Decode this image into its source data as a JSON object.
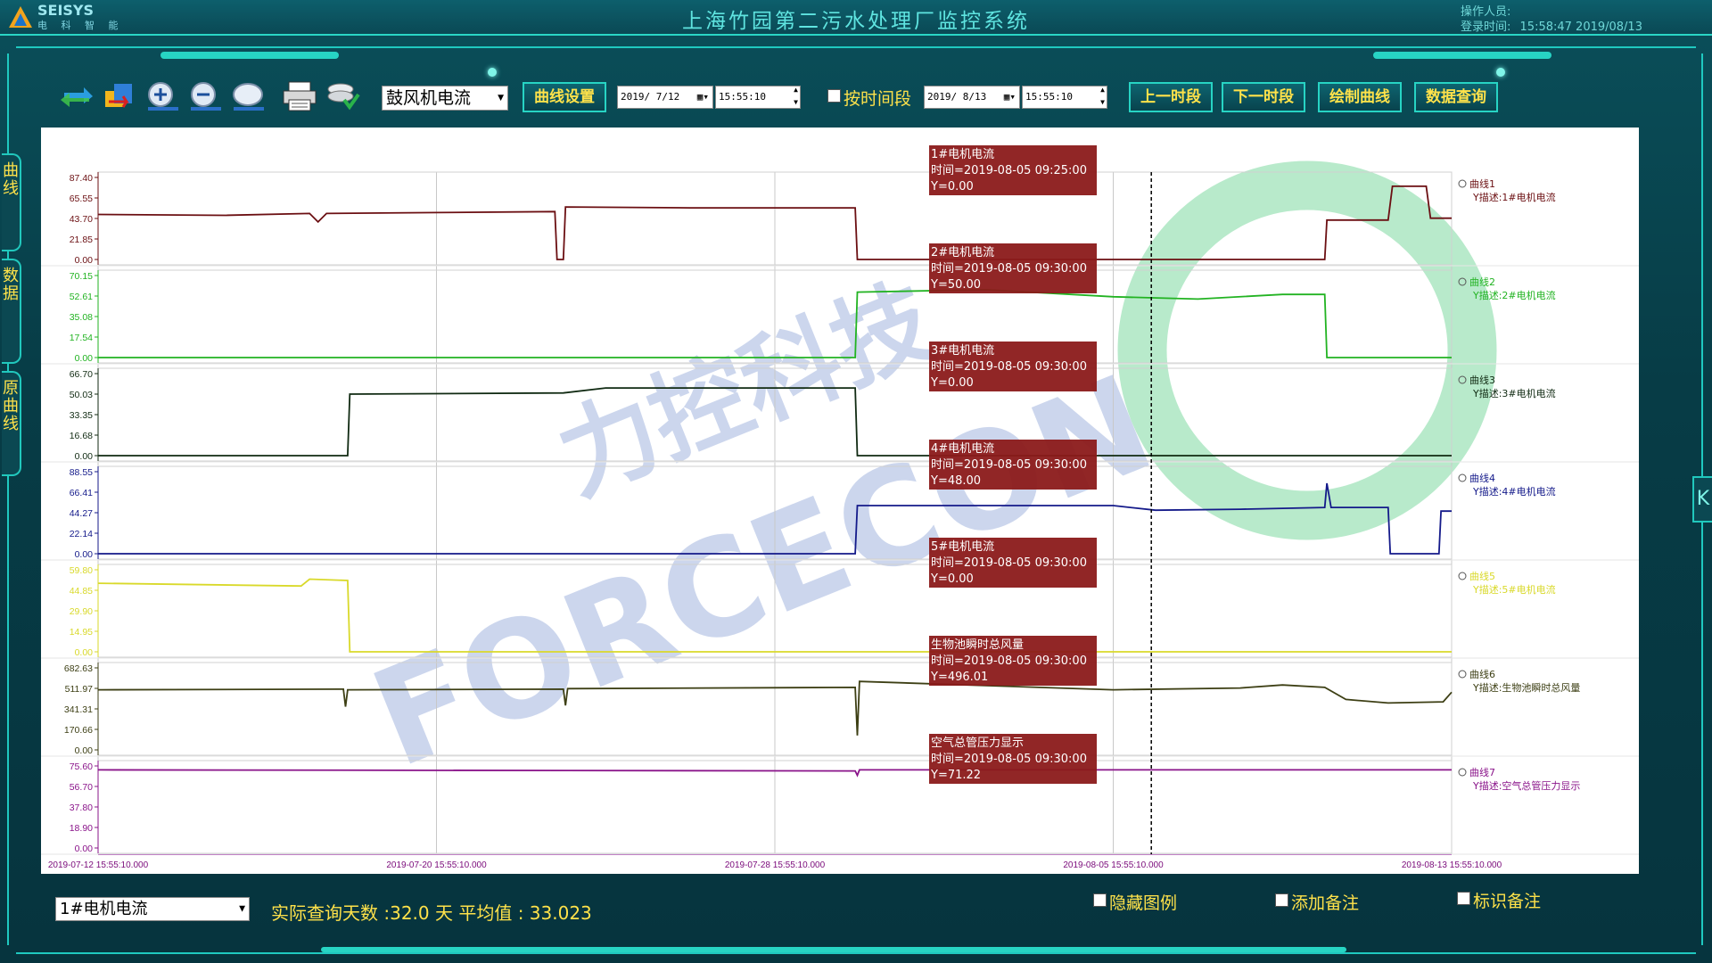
{
  "header": {
    "logo_brand": "SEISYS",
    "logo_sub": "电 科 智 能",
    "title": "上海竹园第二污水处理厂监控系统",
    "operator_label": "操作人员:",
    "login_label": "登录时间:",
    "login_time": "15:58:47 2019/08/13"
  },
  "side_tabs": [
    {
      "label": "曲线"
    },
    {
      "label": "数据"
    },
    {
      "label": "原曲线"
    }
  ],
  "right_tab": {
    "label": "K"
  },
  "toolbar": {
    "icons": [
      "refresh-icon",
      "export-icon",
      "zoom-in-icon",
      "zoom-out-icon",
      "zoom-reset-icon",
      "print-icon",
      "save-icon"
    ],
    "variable_select": "鼓风机电流",
    "curve_settings": "曲线设置",
    "start_date": "2019/ 7/12",
    "start_time": "15:55:10",
    "by_interval_label": "按时间段",
    "end_date": "2019/ 8/13",
    "end_time": "15:55:10",
    "prev_period": "上一时段",
    "next_period": "下一时段",
    "draw_curve": "绘制曲线",
    "data_query": "数据查询"
  },
  "chart_data": {
    "type": "line",
    "x_ticks": [
      "2019-07-12 15:55:10.000",
      "2019-07-20 15:55:10.000",
      "2019-07-28 15:55:10.000",
      "2019-08-05 15:55:10.000",
      "2019-08-13 15:55:10.000"
    ],
    "x_range": [
      "2019-07-12 15:55:10",
      "2019-08-13 15:55:10"
    ],
    "cursor_x": 24.9,
    "watermark": "力控科技 FORCECON",
    "panels": [
      {
        "legend": "曲线1",
        "desc": "Y描述:1#电机电流",
        "color": "#6b0f12",
        "ylim": [
          0,
          87.4
        ],
        "ticks": [
          "87.40",
          "65.55",
          "43.70",
          "21.85",
          "0.00"
        ],
        "tip_title": "1#电机电流",
        "tip_time": "时间=2019-08-05 09:25:00",
        "tip_y": "Y=0.00",
        "series": [
          [
            0,
            48
          ],
          [
            3,
            47
          ],
          [
            5,
            49
          ],
          [
            5.2,
            40
          ],
          [
            5.4,
            49
          ],
          [
            8,
            50
          ],
          [
            10.8,
            51
          ],
          [
            10.85,
            0
          ],
          [
            11.0,
            0
          ],
          [
            11.05,
            56
          ],
          [
            14,
            55
          ],
          [
            17.9,
            55
          ],
          [
            17.95,
            0
          ],
          [
            29,
            0
          ],
          [
            29.05,
            42
          ],
          [
            30.5,
            42
          ],
          [
            30.6,
            78
          ],
          [
            31.4,
            78
          ],
          [
            31.5,
            44
          ],
          [
            32,
            44
          ]
        ]
      },
      {
        "legend": "曲线2",
        "desc": "Y描述:2#电机电流",
        "color": "#22b322",
        "ylim": [
          0,
          70.15
        ],
        "ticks": [
          "70.15",
          "52.61",
          "35.08",
          "17.54",
          "0.00"
        ],
        "tip_title": "2#电机电流",
        "tip_time": "时间=2019-08-05 09:30:00",
        "tip_y": "Y=50.00",
        "series": [
          [
            0,
            0
          ],
          [
            17.9,
            0
          ],
          [
            17.95,
            56
          ],
          [
            21,
            58
          ],
          [
            24,
            52
          ],
          [
            26,
            50
          ],
          [
            28,
            54
          ],
          [
            29,
            54
          ],
          [
            29.05,
            0
          ],
          [
            32,
            0
          ]
        ]
      },
      {
        "legend": "曲线3",
        "desc": "Y描述:3#电机电流",
        "color": "#102a12",
        "ylim": [
          0,
          66.7
        ],
        "ticks": [
          "66.70",
          "50.03",
          "33.35",
          "16.68",
          "0.00"
        ],
        "tip_title": "3#电机电流",
        "tip_time": "时间=2019-08-05 09:30:00",
        "tip_y": "Y=0.00",
        "series": [
          [
            0,
            0
          ],
          [
            5.9,
            0
          ],
          [
            5.95,
            50
          ],
          [
            11,
            51
          ],
          [
            12,
            55
          ],
          [
            17.9,
            55
          ],
          [
            17.95,
            0
          ],
          [
            32,
            0
          ]
        ]
      },
      {
        "legend": "曲线4",
        "desc": "Y描述:4#电机电流",
        "color": "#141a8a",
        "ylim": [
          0,
          88.55
        ],
        "ticks": [
          "88.55",
          "66.41",
          "44.27",
          "22.14",
          "0.00"
        ],
        "tip_title": "4#电机电流",
        "tip_time": "时间=2019-08-05 09:30:00",
        "tip_y": "Y=48.00",
        "series": [
          [
            0,
            0
          ],
          [
            17.9,
            0
          ],
          [
            17.95,
            52
          ],
          [
            24,
            52
          ],
          [
            25,
            47
          ],
          [
            27,
            48
          ],
          [
            29,
            50
          ],
          [
            29.05,
            76
          ],
          [
            29.15,
            50
          ],
          [
            30.5,
            50
          ],
          [
            30.55,
            0
          ],
          [
            31.7,
            0
          ],
          [
            31.75,
            46
          ],
          [
            32,
            46
          ]
        ]
      },
      {
        "legend": "曲线5",
        "desc": "Y描述:5#电机电流",
        "color": "#d9d92a",
        "ylim": [
          0,
          59.8
        ],
        "ticks": [
          "59.80",
          "44.85",
          "29.90",
          "14.95",
          "0.00"
        ],
        "tip_title": "5#电机电流",
        "tip_time": "时间=2019-08-05 09:30:00",
        "tip_y": "Y=0.00",
        "series": [
          [
            0,
            50
          ],
          [
            4.8,
            48
          ],
          [
            5,
            53
          ],
          [
            5.9,
            52
          ],
          [
            5.95,
            0
          ],
          [
            32,
            0
          ]
        ]
      },
      {
        "legend": "曲线6",
        "desc": "Y描述:生物池瞬时总风量",
        "color": "#3d3f14",
        "ylim": [
          0,
          682.63
        ],
        "ticks": [
          "682.63",
          "511.97",
          "341.31",
          "170.66",
          "0.00"
        ],
        "tip_title": "生物池瞬时总风量",
        "tip_time": "时间=2019-08-05 09:30:00",
        "tip_y": "Y=496.01",
        "series": [
          [
            0,
            500
          ],
          [
            5.8,
            505
          ],
          [
            5.85,
            360
          ],
          [
            5.9,
            500
          ],
          [
            11,
            505
          ],
          [
            11.05,
            370
          ],
          [
            11.1,
            510
          ],
          [
            17.9,
            520
          ],
          [
            17.95,
            120
          ],
          [
            18,
            570
          ],
          [
            24,
            500
          ],
          [
            27,
            515
          ],
          [
            28,
            540
          ],
          [
            29,
            520
          ],
          [
            29.5,
            420
          ],
          [
            30.5,
            390
          ],
          [
            31.8,
            400
          ],
          [
            32,
            480
          ]
        ]
      },
      {
        "legend": "曲线7",
        "desc": "Y描述:空气总管压力显示",
        "color": "#8a148a",
        "ylim": [
          0,
          75.6
        ],
        "ticks": [
          "75.60",
          "56.70",
          "37.80",
          "18.90",
          "0.00"
        ],
        "tip_title": "空气总管压力显示",
        "tip_time": "时间=2019-08-05 09:30:00",
        "tip_y": "Y=71.22",
        "series": [
          [
            0,
            72
          ],
          [
            17.9,
            71
          ],
          [
            17.95,
            67
          ],
          [
            18,
            72
          ],
          [
            32,
            72
          ]
        ]
      }
    ]
  },
  "footer": {
    "series_select": "1#电机电流",
    "stats": "实际查询天数 :32.0  天  平均值 : 33.023",
    "hide_legend": "隐藏图例",
    "add_note": "添加备注",
    "mark_note": "标识备注"
  }
}
